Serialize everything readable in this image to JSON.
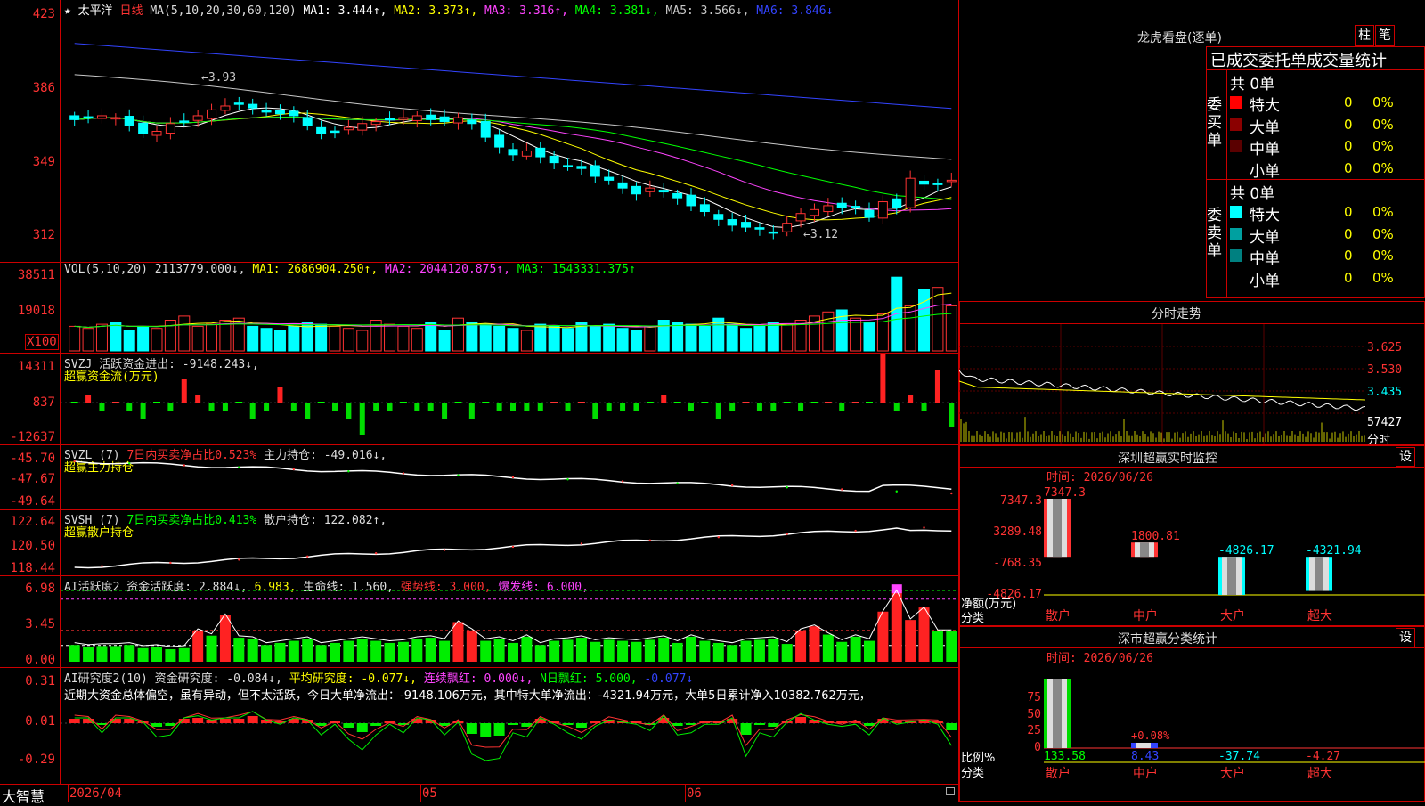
{
  "app": {
    "name": "大智慧"
  },
  "main_chart": {
    "star": "★",
    "stock_name": "太平洋",
    "period": "日线",
    "ma_header": "MA(5,10,20,30,60,120)",
    "ma": [
      {
        "label": "MA1: 3.444↑,",
        "color": "#ffffff"
      },
      {
        "label": "MA2: 3.373↑,",
        "color": "#ffff00"
      },
      {
        "label": "MA3: 3.316↑,",
        "color": "#ff44ff"
      },
      {
        "label": "MA4: 3.381↓,",
        "color": "#00ff00"
      },
      {
        "label": "MA5: 3.566↓,",
        "color": "#c8c8c8"
      },
      {
        "label": "MA6: 3.846↓",
        "color": "#3344ff"
      }
    ],
    "y_ticks": [
      "423",
      "386",
      "349",
      "312"
    ],
    "high_label": "3.93",
    "low_label": "3.12"
  },
  "volume": {
    "header": "VOL(5,10,20) 2113779.000↓,",
    "ma1": "MA1: 2686904.250↑,",
    "ma2": "MA2: 2044120.875↑,",
    "ma3": "MA3: 1543331.375↑",
    "y_ticks": [
      "38511",
      "19018"
    ],
    "unit": "X100"
  },
  "svzj": {
    "header": "SVZJ  活跃资金进出: -9148.243↓,",
    "subtitle": "超赢资金流(万元)",
    "y_ticks": [
      "14311",
      "837",
      "-12637"
    ]
  },
  "svzl": {
    "prefix": "SVZL (7)",
    "green": "7日内买卖净占比0.523%",
    "rest": "主力持仓: -49.016↓,",
    "subtitle": "超赢主力持仓",
    "y_ticks": [
      "-45.70",
      "-47.67",
      "-49.64"
    ]
  },
  "svsh": {
    "prefix": "SVSH (7)",
    "green": "7日内买卖净占比0.413%",
    "rest": "散户持仓: 122.082↑,",
    "subtitle": "超赢散户持仓",
    "y_ticks": [
      "122.64",
      "120.50",
      "118.44"
    ]
  },
  "ai_active": {
    "header": "AI活跃度2 资金活跃度: 2.884↓,",
    "v2": "6.983,",
    "life": "生命线: 1.560,",
    "strong": "强势线: 3.000,",
    "burst": "爆发线: 6.000,",
    "y_ticks": [
      "6.98",
      "3.45",
      "0.00"
    ]
  },
  "ai_research": {
    "header": "AI研究度2(10) 资金研究度: -0.084↓,",
    "avg": "平均研究度: -0.077↓,",
    "red": "连续飘红: 0.000↓,",
    "nday": "N日飘红: 5.000,",
    "nday2": "-0.077↓",
    "comment": "近期大资金总体偏空，虽有异动，但不太活跃，今日大单净流出：-9148.106万元，其中特大单净流出：-4321.94万元，大单5日累计净入10382.762万元，",
    "y_ticks": [
      "0.31",
      "0.01",
      "-0.29"
    ]
  },
  "x_axis": {
    "labels": [
      "2026/04",
      "05",
      "06"
    ]
  },
  "right": {
    "dragon_title": "龙虎看盘(逐单)",
    "btn_zhu": "柱",
    "btn_bi": "笔",
    "table_title": "已成交委托单成交量统计",
    "buy_side": "委买单",
    "sell_side": "委卖单",
    "total_buy": "共 0单",
    "total_sell": "共 0单",
    "buy_rows": [
      {
        "label": "特大",
        "count": "0",
        "pct": "0%",
        "color": "#ff0000"
      },
      {
        "label": "大单",
        "count": "0",
        "pct": "0%",
        "color": "#8b0000"
      },
      {
        "label": "中单",
        "count": "0",
        "pct": "0%",
        "color": "#5a0000"
      },
      {
        "label": "小单",
        "count": "0",
        "pct": "0%",
        "color": ""
      }
    ],
    "sell_rows": [
      {
        "label": "特大",
        "count": "0",
        "pct": "0%",
        "color": "#00ffff"
      },
      {
        "label": "大单",
        "count": "0",
        "pct": "0%",
        "color": "#00a0a0"
      },
      {
        "label": "中单",
        "count": "0",
        "pct": "0%",
        "color": "#008080"
      },
      {
        "label": "小单",
        "count": "0",
        "pct": "0%",
        "color": ""
      }
    ],
    "intraday_title": "分时走势",
    "intraday_ticks": [
      "3.625",
      "3.530",
      "3.435"
    ],
    "intraday_vol": "57427",
    "intraday_unit": "分时",
    "monitor_title": "深圳超赢实时监控",
    "monitor_date": "时间: 2026/06/26",
    "monitor_ticks": [
      "7347.3",
      "3289.48",
      "-768.35",
      "-4826.17"
    ],
    "monitor_net_label": "净额(万元)",
    "monitor_cat_label": "分类",
    "monitor_cats": [
      "散户",
      "中户",
      "大户",
      "超大"
    ],
    "monitor_values": [
      "7347.3",
      "1800.81",
      "-4826.17",
      "-4321.94"
    ],
    "class_title": "深市超赢分类统计",
    "class_date": "时间: 2026/06/26",
    "class_ticks": [
      "75",
      "50",
      "25",
      "0"
    ],
    "class_ratio_label": "比例%",
    "class_cat_label": "分类",
    "class_cats": [
      "散户",
      "中户",
      "大户",
      "超大"
    ],
    "class_values": [
      "133.58",
      "8.43",
      "-37.74",
      "-4.27"
    ],
    "class_bar_label": "+0.08%",
    "settings_glyph": "设"
  },
  "chart_data": {
    "type": "candlestick",
    "x_labels": [
      "2026/04",
      "05",
      "06"
    ],
    "y_ticks": [
      423,
      386,
      349,
      312
    ],
    "high": 3.93,
    "low": 3.12,
    "ma_latest": {
      "MA1": 3.444,
      "MA2": 3.373,
      "MA3": 3.316,
      "MA4": 3.381,
      "MA5": 3.566,
      "MA6": 3.846
    },
    "close_series": [
      3.75,
      3.76,
      3.77,
      3.76,
      3.72,
      3.68,
      3.69,
      3.73,
      3.74,
      3.77,
      3.8,
      3.82,
      3.83,
      3.81,
      3.79,
      3.78,
      3.77,
      3.72,
      3.68,
      3.69,
      3.71,
      3.73,
      3.74,
      3.75,
      3.76,
      3.77,
      3.75,
      3.74,
      3.76,
      3.73,
      3.66,
      3.61,
      3.57,
      3.59,
      3.56,
      3.53,
      3.51,
      3.5,
      3.46,
      3.44,
      3.4,
      3.37,
      3.4,
      3.38,
      3.35,
      3.31,
      3.28,
      3.24,
      3.21,
      3.2,
      3.19,
      3.17,
      3.22,
      3.27,
      3.29,
      3.31,
      3.3,
      3.3,
      3.25,
      3.33,
      3.3,
      3.45,
      3.42,
      3.42,
      3.44
    ],
    "volume_series": [
      12,
      11,
      13,
      14,
      10,
      12,
      11,
      15,
      17,
      12,
      13,
      15,
      16,
      12,
      11,
      10,
      12,
      14,
      13,
      12,
      11,
      10,
      15,
      13,
      12,
      11,
      14,
      10,
      16,
      14,
      13,
      12,
      11,
      10,
      13,
      12,
      11,
      14,
      12,
      13,
      11,
      10,
      12,
      15,
      14,
      13,
      12,
      16,
      13,
      11,
      12,
      14,
      13,
      15,
      17,
      19,
      20,
      16,
      14,
      18,
      36,
      22,
      30,
      31,
      22
    ],
    "svzj_series": [
      0,
      1,
      -1,
      0,
      -1,
      -2,
      0,
      -1,
      3,
      1,
      -1,
      -1,
      0,
      -2,
      -1,
      2,
      -1,
      -2,
      0,
      -1,
      -2,
      -4,
      -1,
      -1,
      0,
      -1,
      -1,
      -2,
      0,
      -2,
      0,
      -1,
      -1,
      -1,
      -1,
      0,
      -1,
      0,
      -2,
      -1,
      -1,
      -1,
      0,
      1,
      0,
      -1,
      0,
      -2,
      -1,
      0,
      -1,
      -1,
      0,
      -1,
      0,
      0,
      -1,
      0,
      0,
      8,
      -1,
      1,
      -1,
      4,
      -3
    ],
    "ai_active_series": [
      1.6,
      1.4,
      1.5,
      1.5,
      1.6,
      1.3,
      1.4,
      1.2,
      1.3,
      3.0,
      2.5,
      4.5,
      2.3,
      2.2,
      1.6,
      1.8,
      2.0,
      2.2,
      1.6,
      1.8,
      2.0,
      2.2,
      2.0,
      1.8,
      1.9,
      2.2,
      2.3,
      2.0,
      3.8,
      3.0,
      2.0,
      2.2,
      1.8,
      2.4,
      1.6,
      2.0,
      2.1,
      2.3,
      1.9,
      2.1,
      2.0,
      1.9,
      2.1,
      2.3,
      1.8,
      2.4,
      2.0,
      1.8,
      1.6,
      2.0,
      2.1,
      2.2,
      1.7,
      3.0,
      3.4,
      2.6,
      1.9,
      2.4,
      2.0,
      4.8,
      6.9,
      4.0,
      5.2,
      2.9,
      2.9
    ],
    "ai_research_series": [
      0.05,
      0.05,
      -0.02,
      0.05,
      0.05,
      0.03,
      -0.04,
      -0.03,
      0.05,
      0.06,
      0.04,
      0.05,
      0.05,
      0.08,
      0.04,
      0.02,
      0.05,
      0.04,
      -0.03,
      0.02,
      -0.05,
      -0.1,
      -0.03,
      0.02,
      -0.02,
      0.05,
      0.04,
      -0.03,
      0.03,
      -0.12,
      -0.15,
      -0.14,
      -0.02,
      -0.04,
      0.05,
      0.02,
      -0.02,
      -0.05,
      0.01,
      0.04,
      0.03,
      0.02,
      -0.01,
      0.06,
      -0.03,
      -0.02,
      0.02,
      0.02,
      0.05,
      -0.13,
      -0.02,
      -0.04,
      0.03,
      0.07,
      0.04,
      0.02,
      0.01,
      0.02,
      -0.03,
      0.05,
      0.02,
      0.03,
      0.04,
      0.02,
      -0.08
    ]
  }
}
